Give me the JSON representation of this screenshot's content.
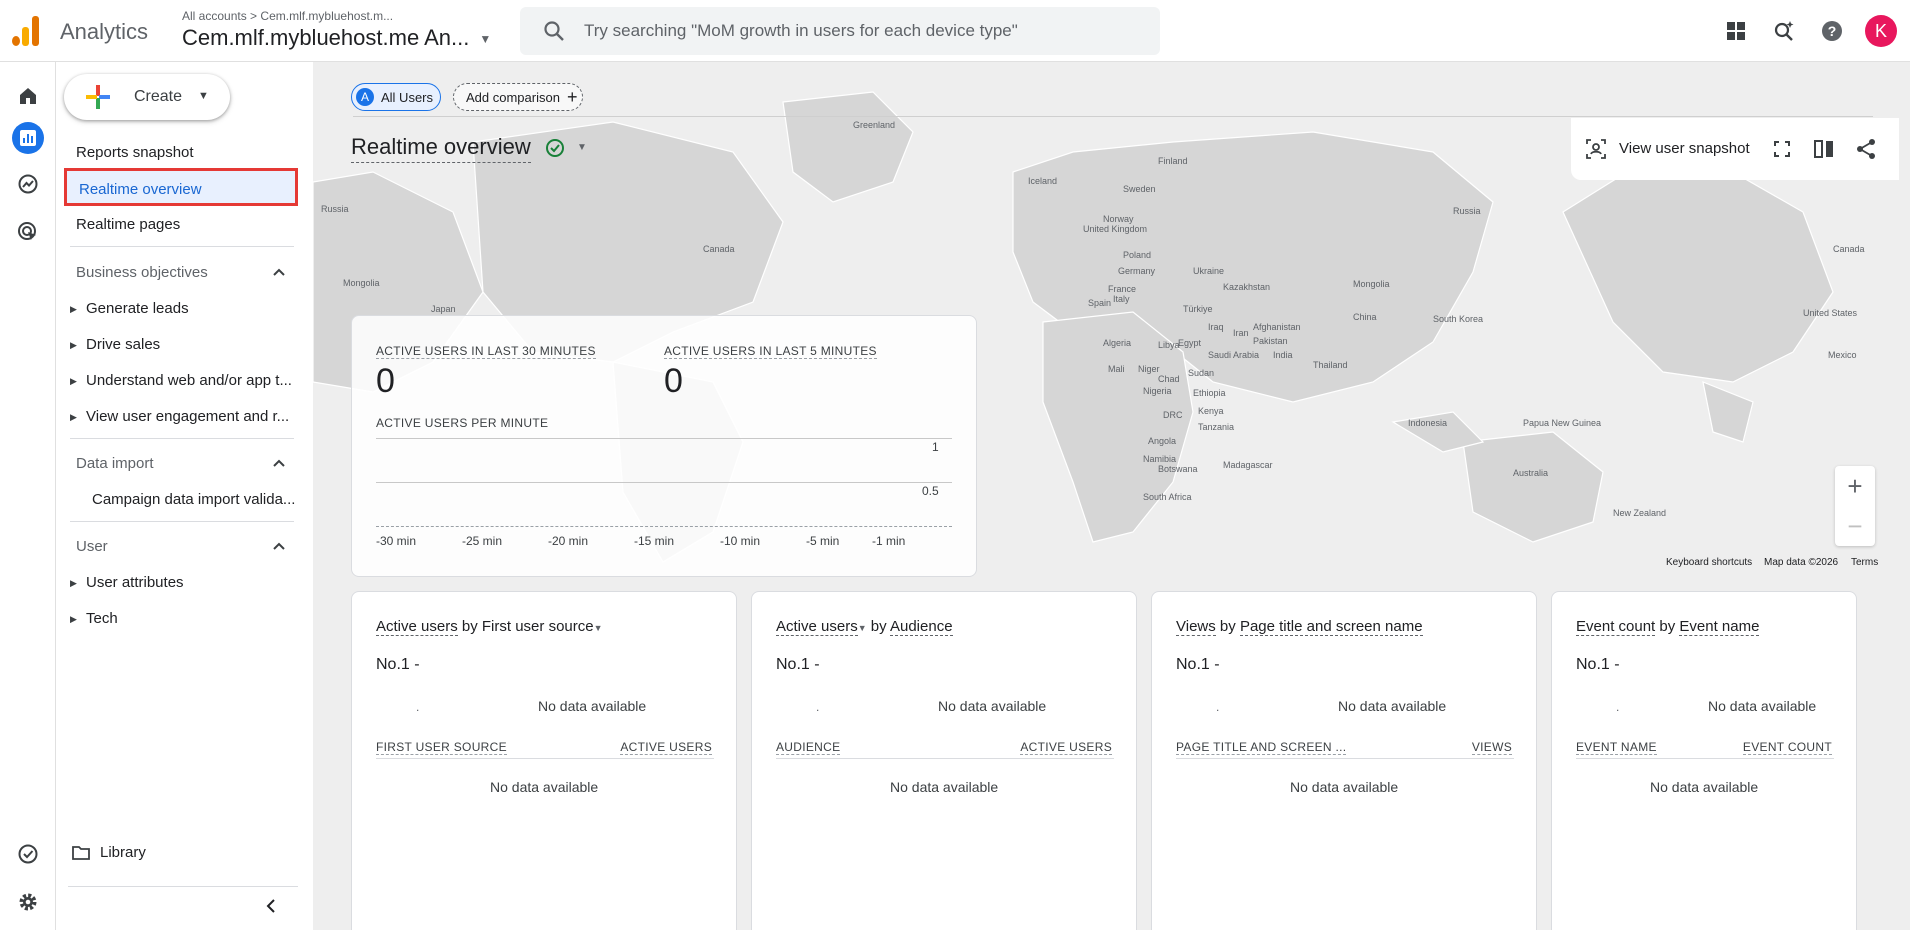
{
  "header": {
    "app_name": "Analytics",
    "breadcrumb_all": "All accounts",
    "breadcrumb_sep": ">",
    "breadcrumb_account": "Cem.mlf.mybluehost.m...",
    "property": "Cem.mlf.mybluehost.me An...",
    "search_placeholder": "Try searching \"MoM growth in users for each device type\"",
    "avatar_letter": "K"
  },
  "nav": {
    "create_label": "Create",
    "reports_snapshot": "Reports snapshot",
    "realtime_overview": "Realtime overview",
    "realtime_pages": "Realtime pages",
    "section_business": "Business objectives",
    "business_items": [
      "Generate leads",
      "Drive sales",
      "Understand web and/or app t...",
      "View user engagement and r..."
    ],
    "section_data_import": "Data import",
    "data_import_item": "Campaign data import valida...",
    "section_user": "User",
    "user_items": [
      "User attributes",
      "Tech"
    ],
    "library": "Library"
  },
  "toolbar": {
    "chip_all_users_letter": "A",
    "chip_all_users": "All Users",
    "add_comparison": "Add comparison",
    "page_title": "Realtime overview",
    "view_user_snapshot": "View user snapshot"
  },
  "map": {
    "labels": [
      {
        "text": "Greenland"
      },
      {
        "text": "Iceland"
      },
      {
        "text": "Finland"
      },
      {
        "text": "Sweden"
      },
      {
        "text": "Norway"
      },
      {
        "text": "Russia"
      },
      {
        "text": "Russia"
      },
      {
        "text": "Canada"
      },
      {
        "text": "Canada"
      },
      {
        "text": "United Kingdom"
      },
      {
        "text": "Poland"
      },
      {
        "text": "Germany"
      },
      {
        "text": "Ukraine"
      },
      {
        "text": "France"
      },
      {
        "text": "Spain"
      },
      {
        "text": "Italy"
      },
      {
        "text": "Kazakhstan"
      },
      {
        "text": "Mongolia"
      },
      {
        "text": "Mongolia"
      },
      {
        "text": "Türkiye"
      },
      {
        "text": "China"
      },
      {
        "text": "Japan"
      },
      {
        "text": "South Korea"
      },
      {
        "text": "Iraq"
      },
      {
        "text": "Iran"
      },
      {
        "text": "Afghanistan"
      },
      {
        "text": "Pakistan"
      },
      {
        "text": "India"
      },
      {
        "text": "Algeria"
      },
      {
        "text": "Libya"
      },
      {
        "text": "Egypt"
      },
      {
        "text": "Saudi Arabia"
      },
      {
        "text": "Mali"
      },
      {
        "text": "Niger"
      },
      {
        "text": "Chad"
      },
      {
        "text": "Sudan"
      },
      {
        "text": "Nigeria"
      },
      {
        "text": "Ethiopia"
      },
      {
        "text": "Thailand"
      },
      {
        "text": "DRC"
      },
      {
        "text": "Kenya"
      },
      {
        "text": "Tanzania"
      },
      {
        "text": "Angola"
      },
      {
        "text": "Indonesia"
      },
      {
        "text": "Papua New Guinea"
      },
      {
        "text": "Namibia"
      },
      {
        "text": "Botswana"
      },
      {
        "text": "Madagascar"
      },
      {
        "text": "Australia"
      },
      {
        "text": "South Africa"
      },
      {
        "text": "New Zealand"
      },
      {
        "text": "United States"
      },
      {
        "text": "Mexico"
      }
    ],
    "keyboard_shortcuts": "Keyboard shortcuts",
    "map_data": "Map data ©2026",
    "terms": "Terms"
  },
  "realtime": {
    "users_30_label": "ACTIVE USERS IN LAST 30 MINUTES",
    "users_30_value": "0",
    "users_5_label": "ACTIVE USERS IN LAST 5 MINUTES",
    "users_5_value": "0",
    "per_minute_label": "ACTIVE USERS PER MINUTE",
    "y_ticks": [
      "1",
      "0.5"
    ],
    "x_ticks": [
      "-30 min",
      "-25 min",
      "-20 min",
      "-15 min",
      "-10 min",
      "-5 min",
      "-1 min"
    ]
  },
  "cards": [
    {
      "metric": "Active users",
      "by": "by",
      "dimension": "First user source",
      "caret_on": "dimension",
      "no1": "No.1  -",
      "nodata": "No data available",
      "col1": "FIRST USER SOURCE",
      "col2": "ACTIVE USERS",
      "nodata2": "No data available"
    },
    {
      "metric": "Active users",
      "by": "by",
      "dimension": "Audience",
      "caret_on": "metric",
      "no1": "No.1  -",
      "nodata": "No data available",
      "col1": "AUDIENCE",
      "col2": "ACTIVE USERS",
      "nodata2": "No data available"
    },
    {
      "metric": "Views",
      "by": "by",
      "dimension": "Page title and screen name",
      "caret_on": "none",
      "no1": "No.1  -",
      "nodata": "No data available",
      "col1": "PAGE TITLE AND SCREEN ...",
      "col2": "VIEWS",
      "nodata2": "No data available"
    },
    {
      "metric": "Event count",
      "by": "by",
      "dimension": "Event name",
      "caret_on": "none",
      "no1": "No.1  -",
      "nodata": "No data available",
      "col1": "EVENT NAME",
      "col2": "EVENT COUNT",
      "nodata2": "No data available"
    }
  ],
  "colors": {
    "accent": "#1a73e8",
    "selected_bg": "#e8f0fe",
    "highlight_border": "#e53935",
    "logo_orange": "#f9ab00",
    "logo_dark": "#e37400",
    "avatar": "#e8175d"
  }
}
